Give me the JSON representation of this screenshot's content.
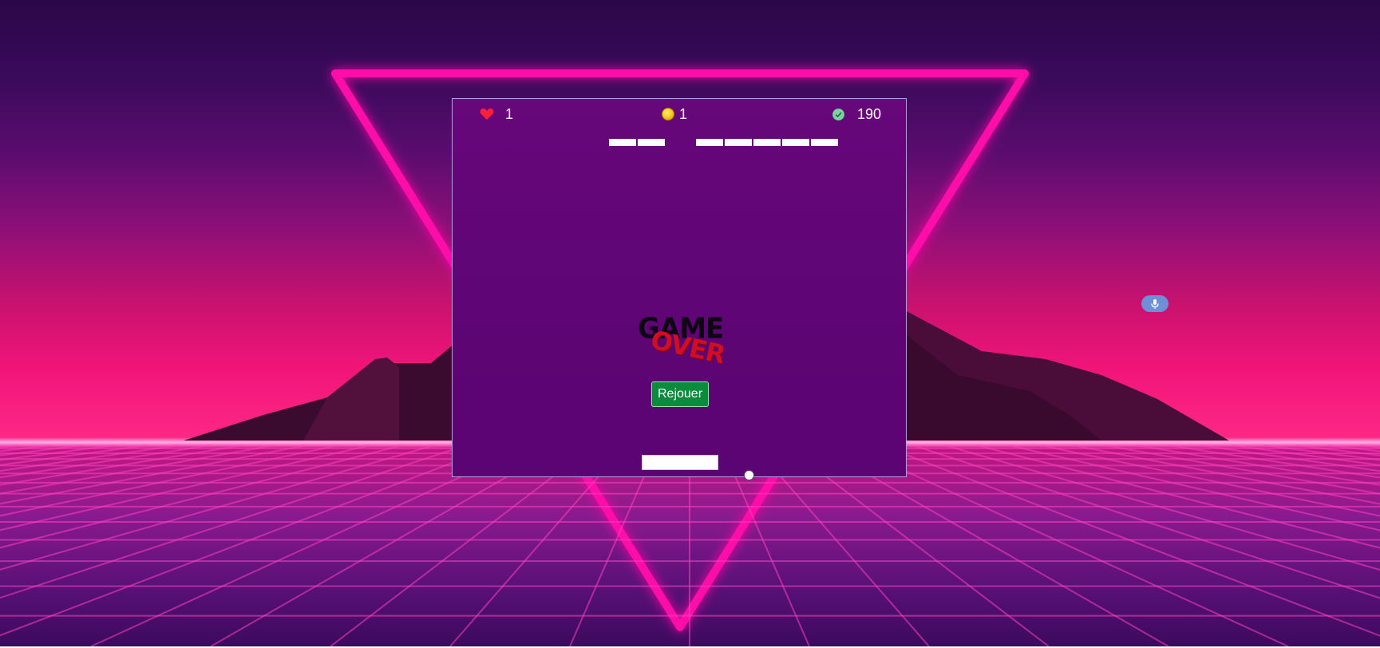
{
  "hud": {
    "lives": "1",
    "coins": "1",
    "score": "190",
    "lives_icon": "heart-icon",
    "coins_icon": "coin-icon",
    "score_icon": "check-circle-icon"
  },
  "game_over": {
    "line1": "GAME",
    "line2": "OVER"
  },
  "replay_button": {
    "label": "Rejouer"
  },
  "mic": {
    "icon": "microphone-icon"
  },
  "colors": {
    "board": "#5f0575",
    "replay_button": "#0d8b3c",
    "lives_icon": "#ff1f3a",
    "coin": "#f6c611",
    "neon": "#ff0fa8"
  }
}
